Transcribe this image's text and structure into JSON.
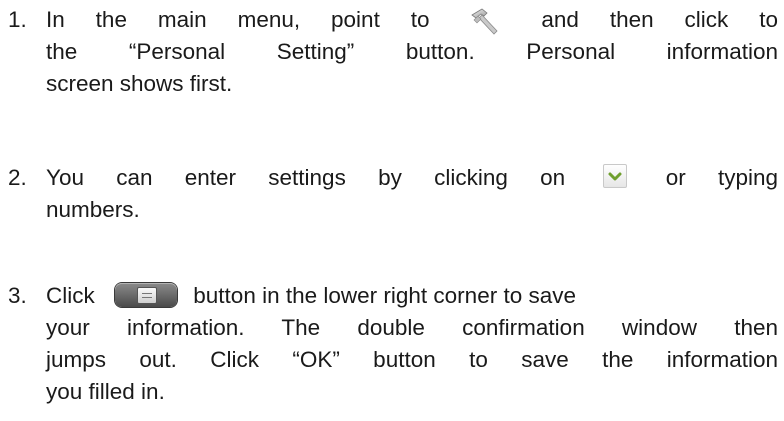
{
  "steps": [
    {
      "number": "1.",
      "line1_a": "In the main menu, point to",
      "line1_b": "and then click to",
      "line2": "the “Personal Setting” button. Personal information",
      "line3": "screen shows first."
    },
    {
      "number": "2.",
      "line1_a": "You can enter settings by clicking on",
      "line1_b": "or typing",
      "line2": "numbers."
    },
    {
      "number": "3.",
      "line1_a": "Click",
      "line1_b": "button in the lower right corner to save",
      "line2": "your information. The double confirmation window then",
      "line3": "jumps out. Click “OK” button to save the information",
      "line4": "you filled in."
    }
  ],
  "icons": {
    "step1": "hammer-icon",
    "step2": "chevron-down-icon",
    "step3": "save-button-icon"
  },
  "colors": {
    "text": "#1a1a1a",
    "chevron": "#6f9f2e",
    "save_button": "#5a5a5a"
  }
}
